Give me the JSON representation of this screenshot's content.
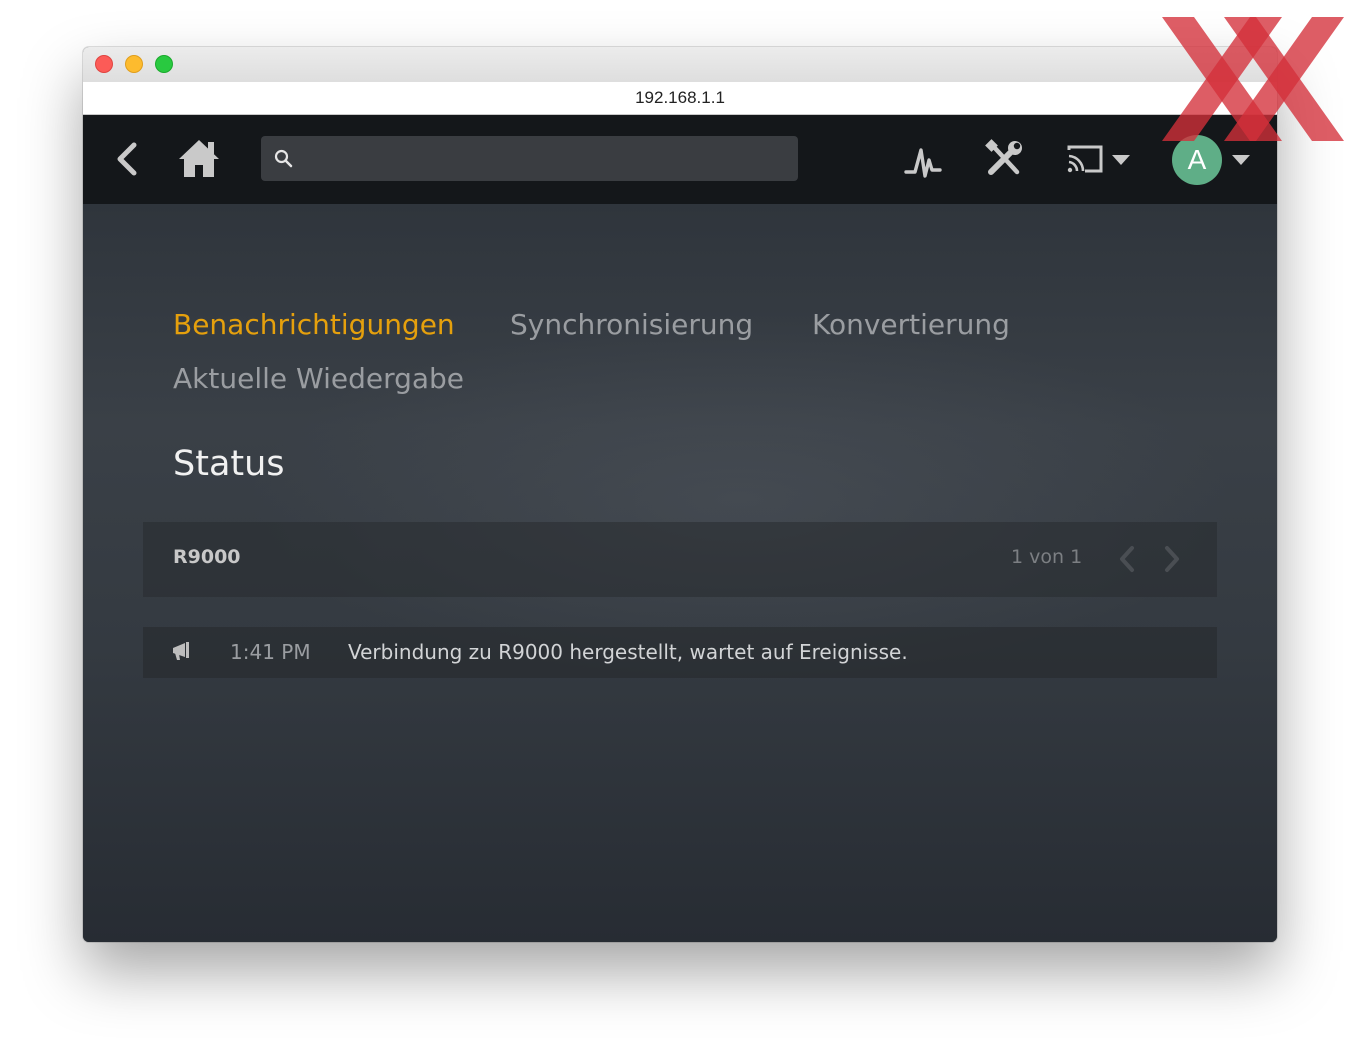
{
  "browser": {
    "url": "192.168.1.1"
  },
  "navbar": {
    "search_placeholder": "",
    "avatar_letter": "A"
  },
  "tabs": [
    {
      "label": "Benachrichtigungen",
      "active": true
    },
    {
      "label": "Synchronisierung",
      "active": false
    },
    {
      "label": "Konvertierung",
      "active": false
    },
    {
      "label": "Aktuelle Wiedergabe",
      "active": false
    }
  ],
  "status": {
    "title": "Status",
    "server_name": "R9000",
    "pager_text": "1 von 1"
  },
  "events": [
    {
      "time": "1:41 PM",
      "message": "Verbindung zu R9000 hergestellt, wartet auf Ereignisse."
    }
  ],
  "colors": {
    "accent": "#e5a00d",
    "avatar": "#5fae87",
    "navbar": "#14171a"
  }
}
